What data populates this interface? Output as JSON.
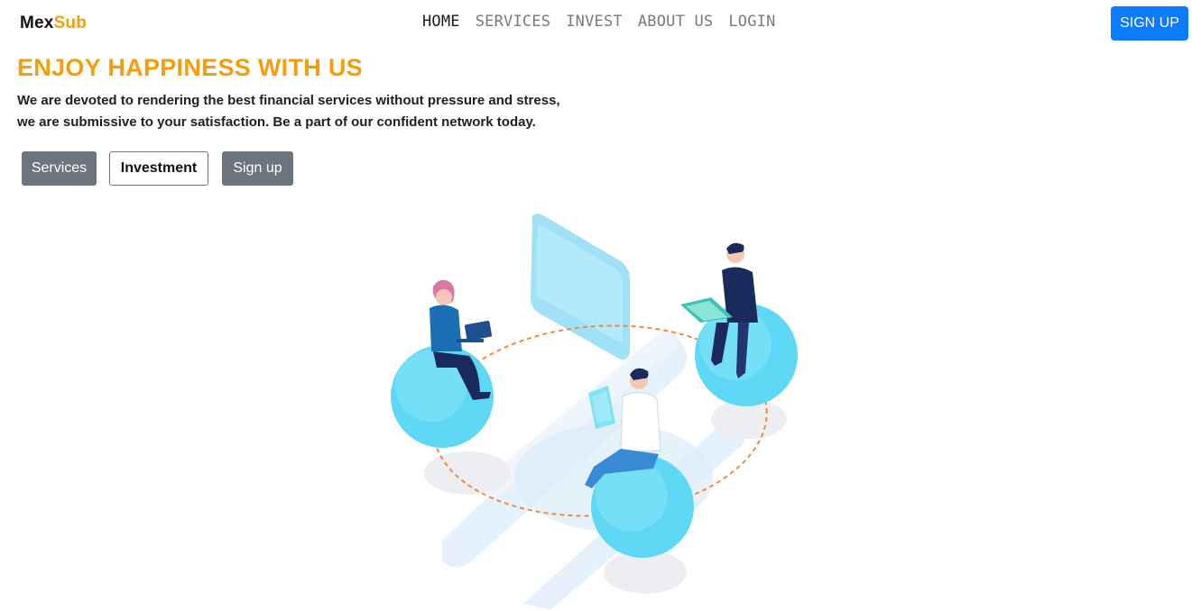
{
  "brand": {
    "part1": "Mex",
    "part2": "Sub"
  },
  "nav": {
    "links": [
      "HOME",
      "SERVICES",
      "INVEST",
      "ABOUT US",
      "LOGIN"
    ],
    "signup_label": "SIGN UP"
  },
  "hero": {
    "title": "ENJOY HAPPINESS WITH US",
    "line1": "We are devoted to rendering the best financial services without pressure and stress,",
    "line2": "we are submissive to your satisfaction. Be a part of our confident network today."
  },
  "actions": {
    "services": "Services",
    "investment": "Investment",
    "signup": "Sign up"
  },
  "colors": {
    "accent": "#f59e0b",
    "primary": "#0d7bff",
    "secondary": "#6c757d"
  }
}
